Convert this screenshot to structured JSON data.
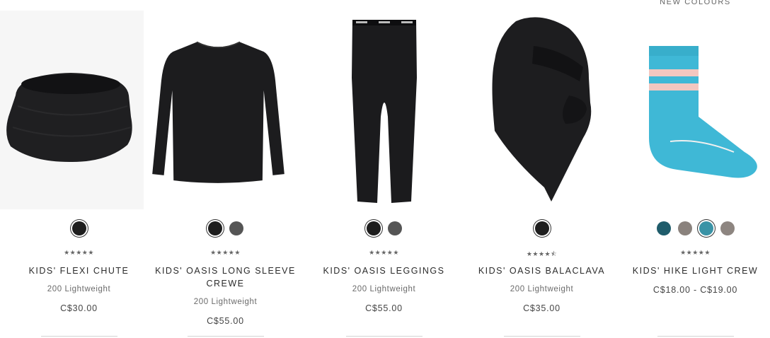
{
  "products": [
    {
      "name": "KIDS' FLEXI CHUTE",
      "weight": "200 Lightweight",
      "price": "C$30.00",
      "rating": "★★★★★",
      "rating_value": 5,
      "image_icon": "neck-gaiter-icon",
      "swatches": [
        {
          "color": "#1e1e1e",
          "selected": true
        }
      ]
    },
    {
      "name": "KIDS' OASIS LONG SLEEVE CREWE",
      "weight": "200 Lightweight",
      "price": "C$55.00",
      "rating": "★★★★★",
      "rating_value": 5,
      "image_icon": "long-sleeve-shirt-icon",
      "swatches": [
        {
          "color": "#1e1e1e",
          "selected": true
        },
        {
          "color": "#555555",
          "selected": false
        }
      ]
    },
    {
      "name": "KIDS' OASIS LEGGINGS",
      "weight": "200 Lightweight",
      "price": "C$55.00",
      "rating": "★★★★★",
      "rating_value": 5,
      "image_icon": "leggings-icon",
      "swatches": [
        {
          "color": "#1e1e1e",
          "selected": true
        },
        {
          "color": "#555555",
          "selected": false
        }
      ]
    },
    {
      "name": "KIDS' OASIS BALACLAVA",
      "weight": "200 Lightweight",
      "price": "C$35.00",
      "rating": "★★★★⯪",
      "rating_value": 4.5,
      "image_icon": "balaclava-icon",
      "swatches": [
        {
          "color": "#1e1e1e",
          "selected": true
        }
      ]
    },
    {
      "name": "KIDS' HIKE LIGHT CREW",
      "badge": "NEW COLOURS",
      "price": "C$18.00 - C$19.00",
      "rating": "★★★★★",
      "rating_value": 5,
      "image_icon": "sock-icon",
      "swatches": [
        {
          "color": "#1f5c6b",
          "selected": false
        },
        {
          "color": "#8a827d",
          "selected": false
        },
        {
          "color": "#3a93a6",
          "selected": true
        },
        {
          "color": "#8d8580",
          "selected": false
        }
      ]
    }
  ]
}
